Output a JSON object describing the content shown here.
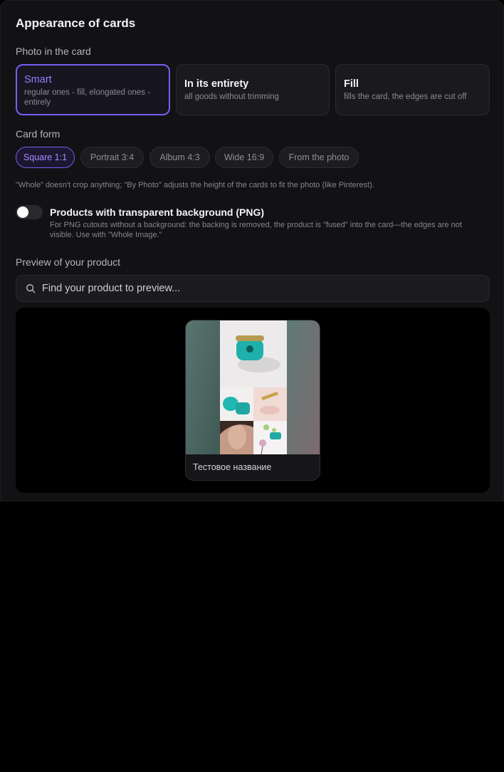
{
  "header": {
    "title": "Appearance of cards"
  },
  "photo_in_card": {
    "label": "Photo in the card",
    "options": [
      {
        "title": "Smart",
        "desc": "regular ones - fill, elongated ones - entirely",
        "selected": true
      },
      {
        "title": "In its entirety",
        "desc": "all goods without trimming",
        "selected": false
      },
      {
        "title": "Fill",
        "desc": "fills the card, the edges are cut off",
        "selected": false
      }
    ]
  },
  "card_form": {
    "label": "Card form",
    "options": [
      {
        "label": "Square 1:1",
        "selected": true
      },
      {
        "label": "Portrait 3:4",
        "selected": false
      },
      {
        "label": "Album 4:3",
        "selected": false
      },
      {
        "label": "Wide 16:9",
        "selected": false
      },
      {
        "label": "From the photo",
        "selected": false
      }
    ],
    "hint": "\"Whole\" doesn't crop anything; \"By Photo\" adjusts the height of the cards to fit the photo (like Pinterest)."
  },
  "png_toggle": {
    "title": "Products with transparent background (PNG)",
    "desc": "For PNG cutouts without a background: the backing is removed, the product is \"fused\" into the card—the edges are not visible. Use with \"Whole Image.\"",
    "enabled": false
  },
  "preview": {
    "label": "Preview of your product",
    "search_placeholder": "Find your product to preview...",
    "card_name": "Тестовое название"
  },
  "colors": {
    "accent": "#7b5cf0",
    "panel": "#121214",
    "background": "#000000"
  }
}
